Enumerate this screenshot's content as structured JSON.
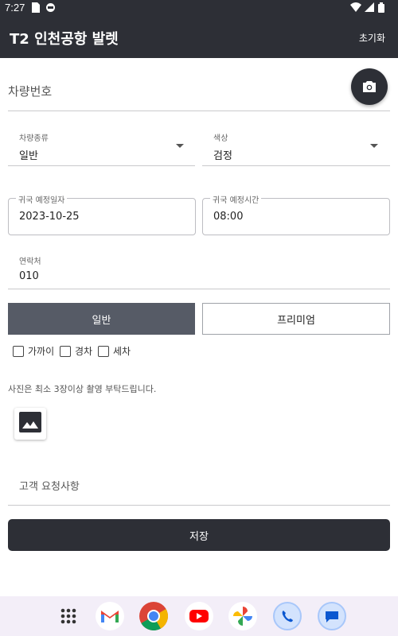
{
  "status_bar": {
    "time": "7:27"
  },
  "app_bar": {
    "title": "T2 인천공항 발렛",
    "reset_label": "초기화"
  },
  "form": {
    "plate": {
      "label": "차량번호"
    },
    "vehicle_type": {
      "label": "차량종류",
      "value": "일반"
    },
    "color": {
      "label": "색상",
      "value": "검정"
    },
    "return_date": {
      "label": "귀국 예정일자",
      "value": "2023-10-25"
    },
    "return_time": {
      "label": "귀국 예정시간",
      "value": "08:00"
    },
    "contact": {
      "label": "연락처",
      "value": "010"
    },
    "service_type": {
      "options": [
        "일반",
        "프리미엄"
      ],
      "selected": "일반"
    },
    "extras": [
      {
        "label": "가까이",
        "checked": false
      },
      {
        "label": "경차",
        "checked": false
      },
      {
        "label": "세차",
        "checked": false
      }
    ],
    "photo_notice": "사진은 최소 3장이상 촬영 부탁드립니다.",
    "request": {
      "label": "고객 요청사항"
    },
    "save_label": "저장"
  },
  "dock": {
    "apps": [
      "app-drawer-icon",
      "gmail-icon",
      "chrome-icon",
      "youtube-icon",
      "photos-icon",
      "phone-icon",
      "messages-icon"
    ]
  },
  "colors": {
    "primary": "#2d2f36",
    "toggle_active": "#565b66"
  }
}
